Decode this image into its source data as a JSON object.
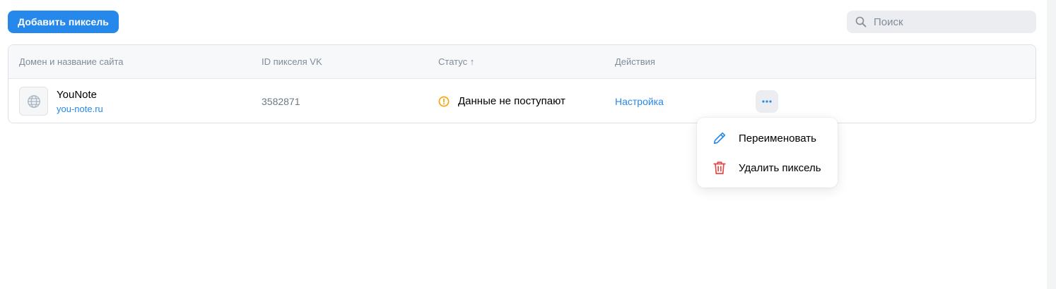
{
  "toolbar": {
    "add_pixel_label": "Добавить пиксель"
  },
  "search": {
    "placeholder": "Поиск",
    "value": ""
  },
  "table": {
    "headers": {
      "domain": "Домен и название сайта",
      "pixel_id": "ID пикселя VK",
      "status": "Статус ↑",
      "actions": "Действия"
    },
    "rows": [
      {
        "site_name": "YouNote",
        "domain": "you-note.ru",
        "pixel_id": "3582871",
        "status": "Данные не поступают",
        "status_icon": "warning-circle-icon",
        "action_link": "Настройка",
        "more_label": "•••"
      }
    ]
  },
  "menu": {
    "items": [
      {
        "label": "Переименовать",
        "icon": "pencil-icon"
      },
      {
        "label": "Удалить пиксель",
        "icon": "trash-icon"
      }
    ]
  },
  "colors": {
    "accent": "#2688eb",
    "warning": "#ffa000",
    "danger": "#e64646",
    "muted_text": "#818c99"
  }
}
